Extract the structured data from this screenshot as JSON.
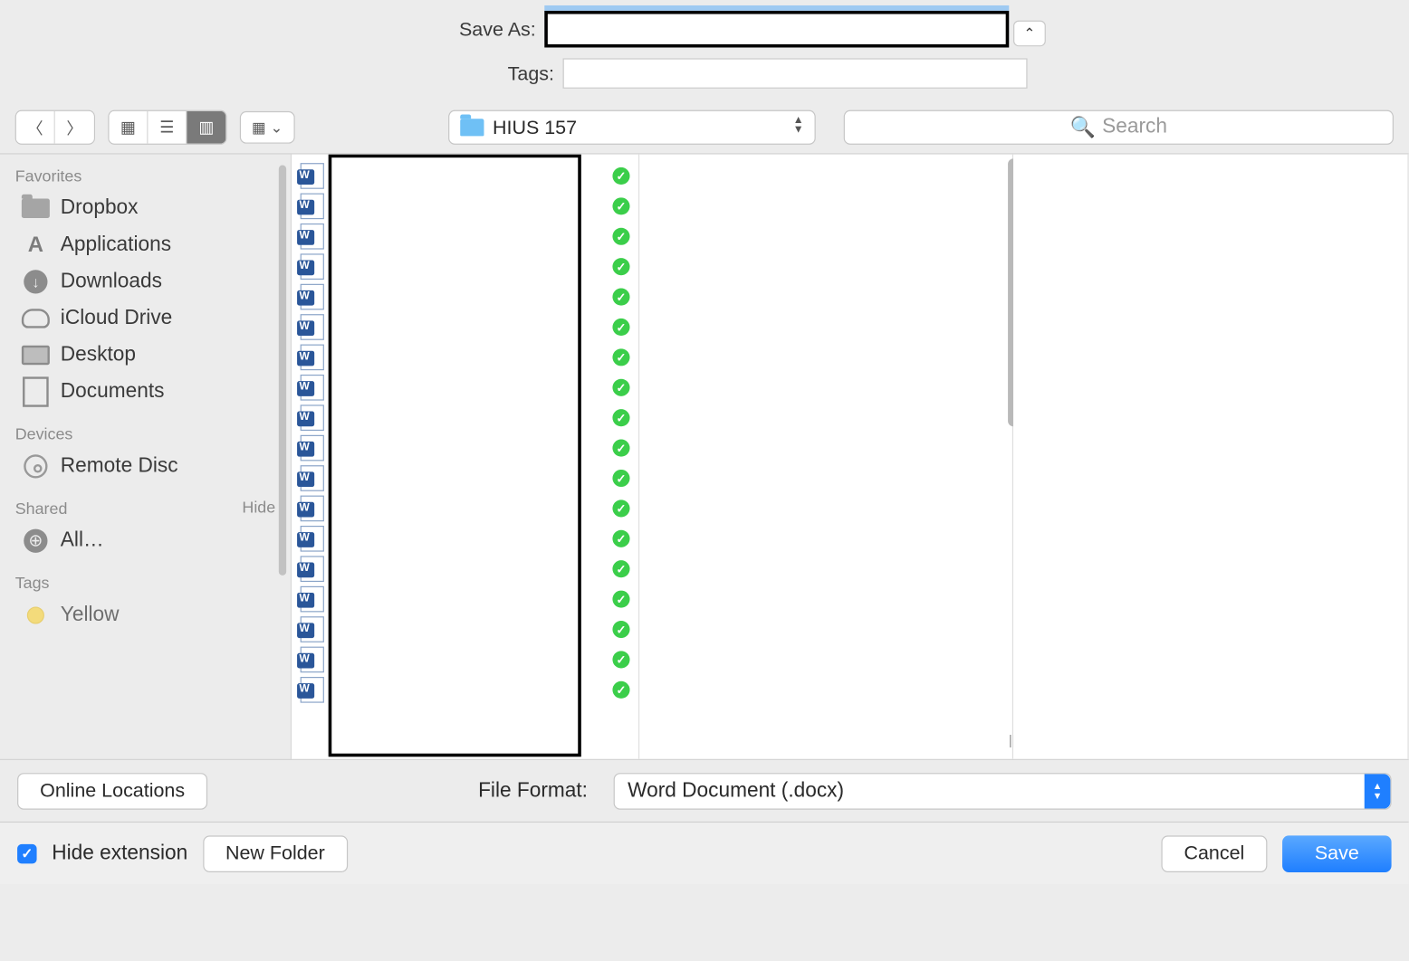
{
  "top": {
    "save_as_label": "Save As:",
    "save_as_value": "",
    "tags_label": "Tags:",
    "tags_value": ""
  },
  "toolbar": {
    "current_folder": "HIUS 157",
    "search_placeholder": "Search"
  },
  "sidebar": {
    "favorites_label": "Favorites",
    "items": [
      {
        "label": "Dropbox"
      },
      {
        "label": "Applications"
      },
      {
        "label": "Downloads"
      },
      {
        "label": "iCloud Drive"
      },
      {
        "label": "Desktop"
      },
      {
        "label": "Documents"
      }
    ],
    "devices_label": "Devices",
    "devices": [
      {
        "label": "Remote Disc"
      }
    ],
    "shared_label": "Shared",
    "shared_hide": "Hide",
    "shared_items": [
      {
        "label": "All…"
      }
    ],
    "tags_label": "Tags",
    "tags": [
      {
        "label": "Yellow"
      }
    ]
  },
  "files": {
    "count": 18
  },
  "format_bar": {
    "online_locations": "Online Locations",
    "file_format_label": "File Format:",
    "file_format_value": "Word Document (.docx)"
  },
  "bottom": {
    "hide_extension": "Hide extension",
    "new_folder": "New Folder",
    "cancel": "Cancel",
    "save": "Save"
  }
}
